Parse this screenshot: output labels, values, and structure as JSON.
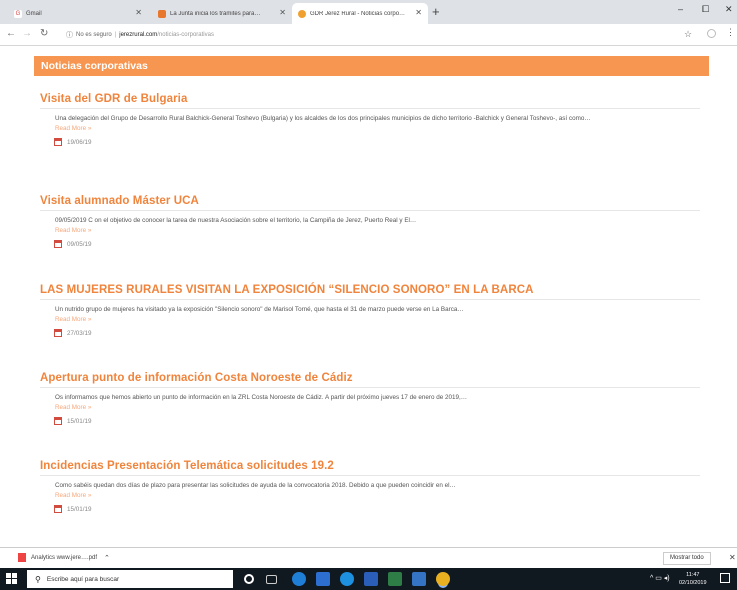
{
  "browser": {
    "tabs": [
      {
        "label": "Gmail",
        "favicon_color": "#ffffff",
        "favicon_glyph": "G"
      },
      {
        "label": "La Junta inicia los trámites para…",
        "favicon_color": "#e8772e"
      },
      {
        "label": "GDR Jerez Rural - Noticias corpo…",
        "favicon_color": "#f0a030"
      }
    ],
    "new_tab": "+",
    "window_controls": {
      "minimize": "–",
      "maximize": "⧠",
      "close": "✕"
    },
    "address": {
      "security": "No es seguro",
      "host": "jerezrural.com",
      "path": "/noticias-corporativas"
    }
  },
  "page": {
    "section_title": "Noticias corporativas",
    "read_more_label": "Read More »",
    "articles": [
      {
        "title": "Visita del GDR de Bulgaria",
        "excerpt": "Una delegación del Grupo de Desarrollo Rural Balchick-General Toshevo (Bulgaria) y los alcaldes de los dos principales municipios de dicho territorio -Balchick y General Toshevo-, así como…",
        "date": "19/06/19"
      },
      {
        "title": "Visita alumnado Máster UCA",
        "excerpt": "09/05/2019 C on el objetivo de conocer la tarea de nuestra Asociación sobre el territorio, la Campiña de Jerez, Puerto Real y El…",
        "date": "09/05/19"
      },
      {
        "title": "LAS MUJERES RURALES VISITAN LA EXPOSICIÓN “SILENCIO SONORO” EN LA BARCA",
        "excerpt": "Un nutrido grupo de mujeres ha visitado ya la exposición \"Silencio sonoro\" de Marisol Torné, que hasta el 31 de marzo puede verse en La Barca…",
        "date": "27/03/19"
      },
      {
        "title": "Apertura punto de información Costa Noroeste de Cádiz",
        "excerpt": "Os informamos que hemos abierto un punto de información en la ZRL Costa Noroeste de Cádiz. A partir del próximo jueves 17 de enero de 2019,…",
        "date": "15/01/19"
      },
      {
        "title": "Incidencias Presentación Telemática solicitudes 19.2",
        "excerpt": "Como sabéis quedan dos días de plazo para presentar las solicitudes de ayuda de la convocatoria 2018. Debido a que pueden coincidir en el…",
        "date": "15/01/19"
      }
    ]
  },
  "downloads": {
    "file": "Analytics www.jere….pdf",
    "show_all": "Mostrar todo"
  },
  "taskbar": {
    "search_placeholder": "Escribe aquí para buscar",
    "time": "11:47",
    "date": "02/10/2019"
  },
  "colors": {
    "accent": "#f79650",
    "title": "#f0843c",
    "read_more": "#f6a77a"
  }
}
